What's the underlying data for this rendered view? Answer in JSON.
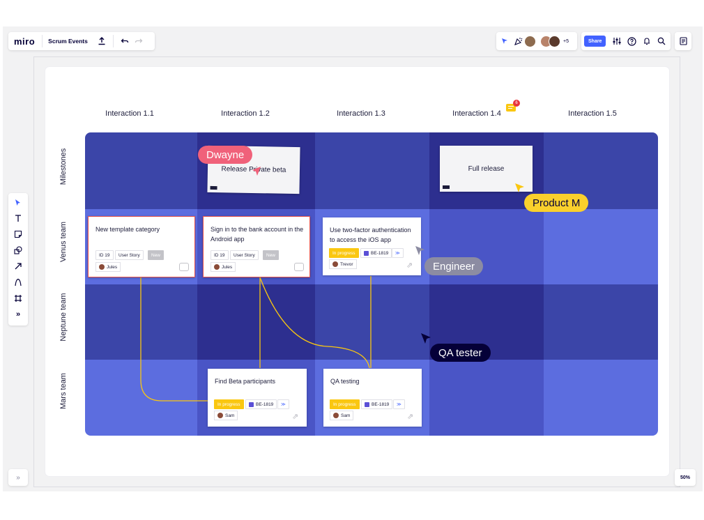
{
  "toolbar": {
    "logo": "miro",
    "board_name": "Scrum Events",
    "upload_icon": "upload-icon",
    "undo_icon": "undo-icon",
    "redo_icon": "redo-icon",
    "collab_count": "+5",
    "share_label": "Share",
    "zoom": "50%",
    "expand_label": "»"
  },
  "columns": [
    "Interaction 1.1",
    "Interaction 1.2",
    "Interaction 1.3",
    "Interaction 1.4",
    "Interaction 1.5"
  ],
  "rows": [
    "Milestones",
    "Venus team",
    "Neptune team",
    "Mars team"
  ],
  "comment_badge": "6",
  "milestones": {
    "release": "Release Private beta",
    "full": "Full release"
  },
  "cards": {
    "c1": {
      "title": "New template category",
      "id": "ID 19",
      "type": "User Story",
      "status": "New",
      "user": "Jules"
    },
    "c2": {
      "title": "Sign in to the bank account in the Android app",
      "id": "ID 19",
      "type": "User Story",
      "status": "New",
      "user": "Jules"
    },
    "c3": {
      "title": "Use two-factor authentication to access the iOS app",
      "status": "In progress",
      "key": "BE-1819",
      "user": "Trevor"
    },
    "c4": {
      "title": "Find Beta participants",
      "status": "In progress",
      "key": "BE-1819",
      "user": "Sam"
    },
    "c5": {
      "title": "QA testing",
      "status": "In progress",
      "key": "BE-1819",
      "user": "Sam"
    }
  },
  "cursors": {
    "dwayne": "Dwayne",
    "product": "Product M",
    "engineer": "Engineer",
    "qa": "QA tester"
  },
  "colors": {
    "dark": "#2d2f8f",
    "mid": "#3b45a8",
    "light": "#5c6ddf",
    "accent": "#4262ff",
    "yellow": "#fac710",
    "red": "#e8534a"
  },
  "left_tools": [
    "cursor-icon",
    "text-icon",
    "sticky-note-icon",
    "shapes-icon",
    "arrow-icon",
    "pen-icon",
    "frame-icon",
    "more-icon"
  ]
}
